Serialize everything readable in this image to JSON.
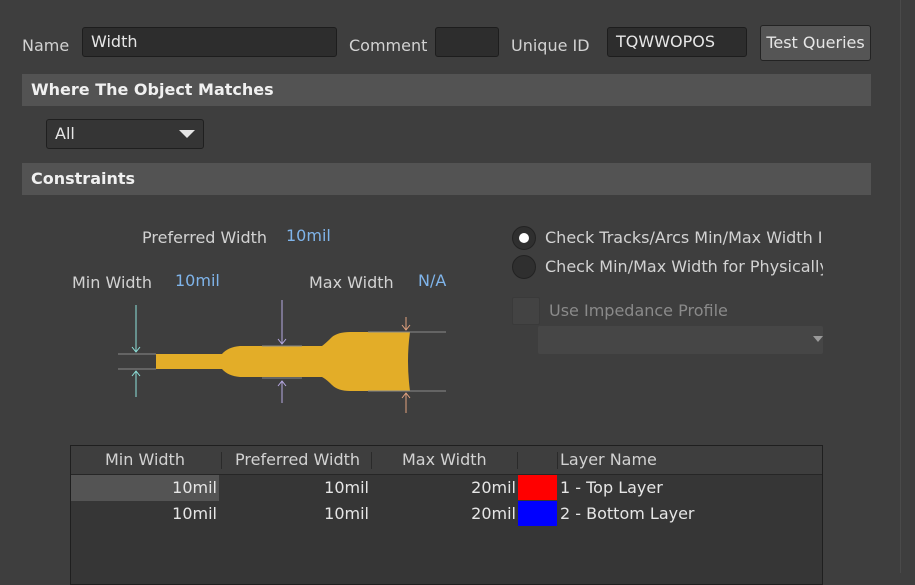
{
  "form": {
    "name_label": "Name",
    "name_value": "Width",
    "comment_label": "Comment",
    "comment_value": "",
    "unique_id_label": "Unique ID",
    "unique_id_value": "TQWWOPOS",
    "test_queries_label": "Test Queries"
  },
  "where": {
    "title": "Where The Object Matches",
    "scope_value": "All"
  },
  "constraints": {
    "title": "Constraints",
    "preferred_width_label": "Preferred Width",
    "preferred_width_value": "10mil",
    "min_width_label": "Min Width",
    "min_width_value": "10mil",
    "max_width_label": "Max Width",
    "max_width_value": "N/A",
    "radio_check_tracks": "Check Tracks/Arcs Min/Max Width In",
    "radio_check_physically": "Check Min/Max Width for Physically",
    "radio_selected": "check_tracks",
    "use_impedance_label": "Use Impedance Profile",
    "use_impedance_checked": false,
    "impedance_profile_value": ""
  },
  "table": {
    "headers": [
      "Min Width",
      "Preferred Width",
      "Max Width",
      "",
      "Layer Name"
    ],
    "rows": [
      {
        "min": "10mil",
        "pref": "10mil",
        "max": "20mil",
        "color": "#ff0000",
        "layer": "1 - Top Layer"
      },
      {
        "min": "10mil",
        "pref": "10mil",
        "max": "20mil",
        "color": "#0000ff",
        "layer": "2 - Bottom Layer"
      }
    ]
  },
  "colors": {
    "track": "#e3ad28",
    "min_marker": "#8fe3dc",
    "pref_marker": "#b7a9e3",
    "max_marker": "#e3a27f"
  }
}
